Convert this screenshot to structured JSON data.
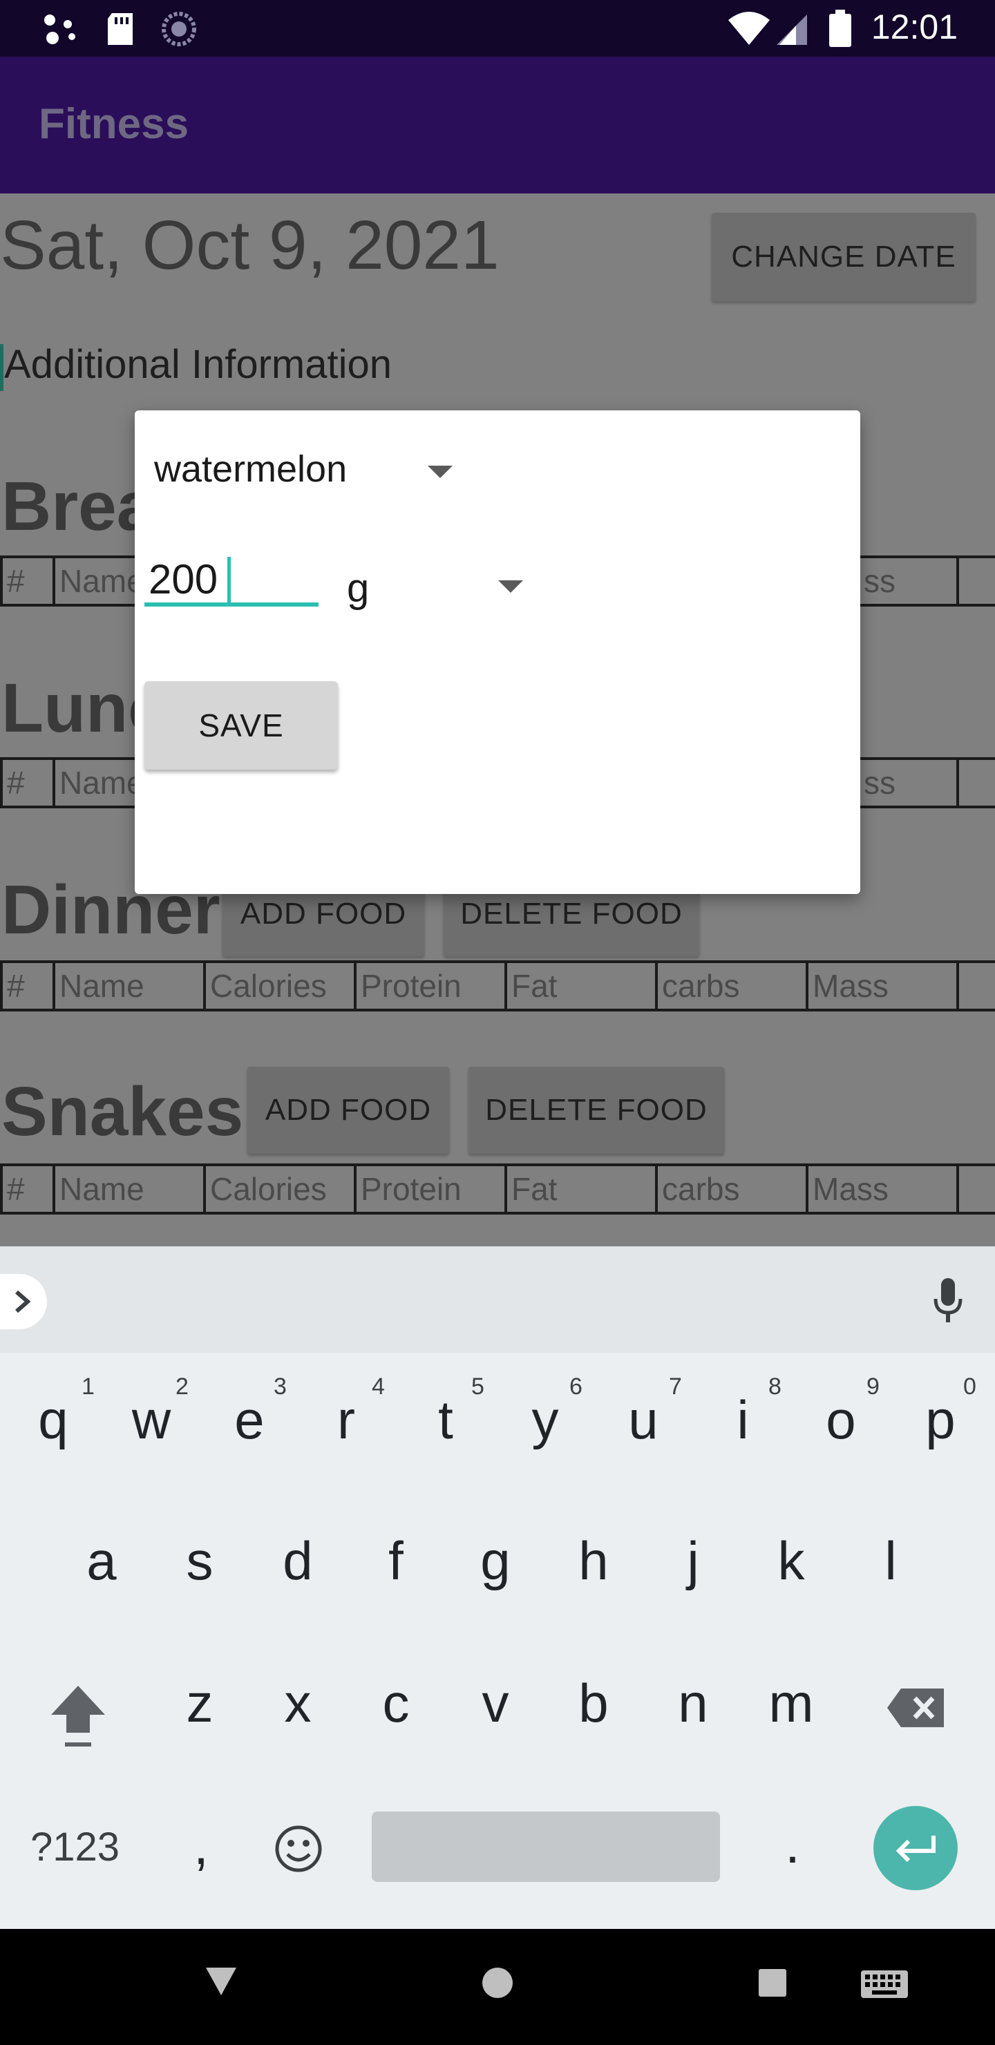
{
  "status_bar": {
    "time": "12:01",
    "icons_left": [
      "assistant-dots-icon",
      "sd-card-icon",
      "sync-circle-icon"
    ],
    "icons_right": [
      "wifi-icon",
      "cell-signal-icon",
      "battery-icon"
    ]
  },
  "app_bar": {
    "title": "Fitness"
  },
  "content": {
    "date": "Sat, Oct 9, 2021",
    "change_date_label": "CHANGE DATE",
    "additional_info": "Additional Information",
    "sections": [
      {
        "title": "Brea"
      },
      {
        "title": "Lunc"
      },
      {
        "title": "Dinner",
        "add_label": "ADD FOOD",
        "delete_label": "DELETE FOOD"
      },
      {
        "title": "Snakes",
        "add_label": "ADD FOOD",
        "delete_label": "DELETE FOOD"
      }
    ],
    "table_headers": [
      "#",
      "Name",
      "Calories",
      "Protein",
      "Fat",
      "carbs",
      "Mass"
    ],
    "table_partial": {
      "hash": "#",
      "name": "Name",
      "mass_tail": "ss"
    }
  },
  "dialog": {
    "food_selected": "watermelon",
    "amount_value": "200",
    "unit_selected": "g",
    "save_label": "SAVE"
  },
  "keyboard": {
    "row1": [
      "q",
      "w",
      "e",
      "r",
      "t",
      "y",
      "u",
      "i",
      "o",
      "p"
    ],
    "row1_hints": [
      "1",
      "2",
      "3",
      "4",
      "5",
      "6",
      "7",
      "8",
      "9",
      "0"
    ],
    "row2": [
      "a",
      "s",
      "d",
      "f",
      "g",
      "h",
      "j",
      "k",
      "l"
    ],
    "row3": [
      "z",
      "x",
      "c",
      "v",
      "b",
      "n",
      "m"
    ],
    "symbols_label": "?123",
    "comma": ",",
    "period": "."
  },
  "colors": {
    "status_bar": "#12062a",
    "app_bar": "#2b0e5a",
    "accent": "#2bbfb2",
    "enter_key": "#4db6ac"
  }
}
